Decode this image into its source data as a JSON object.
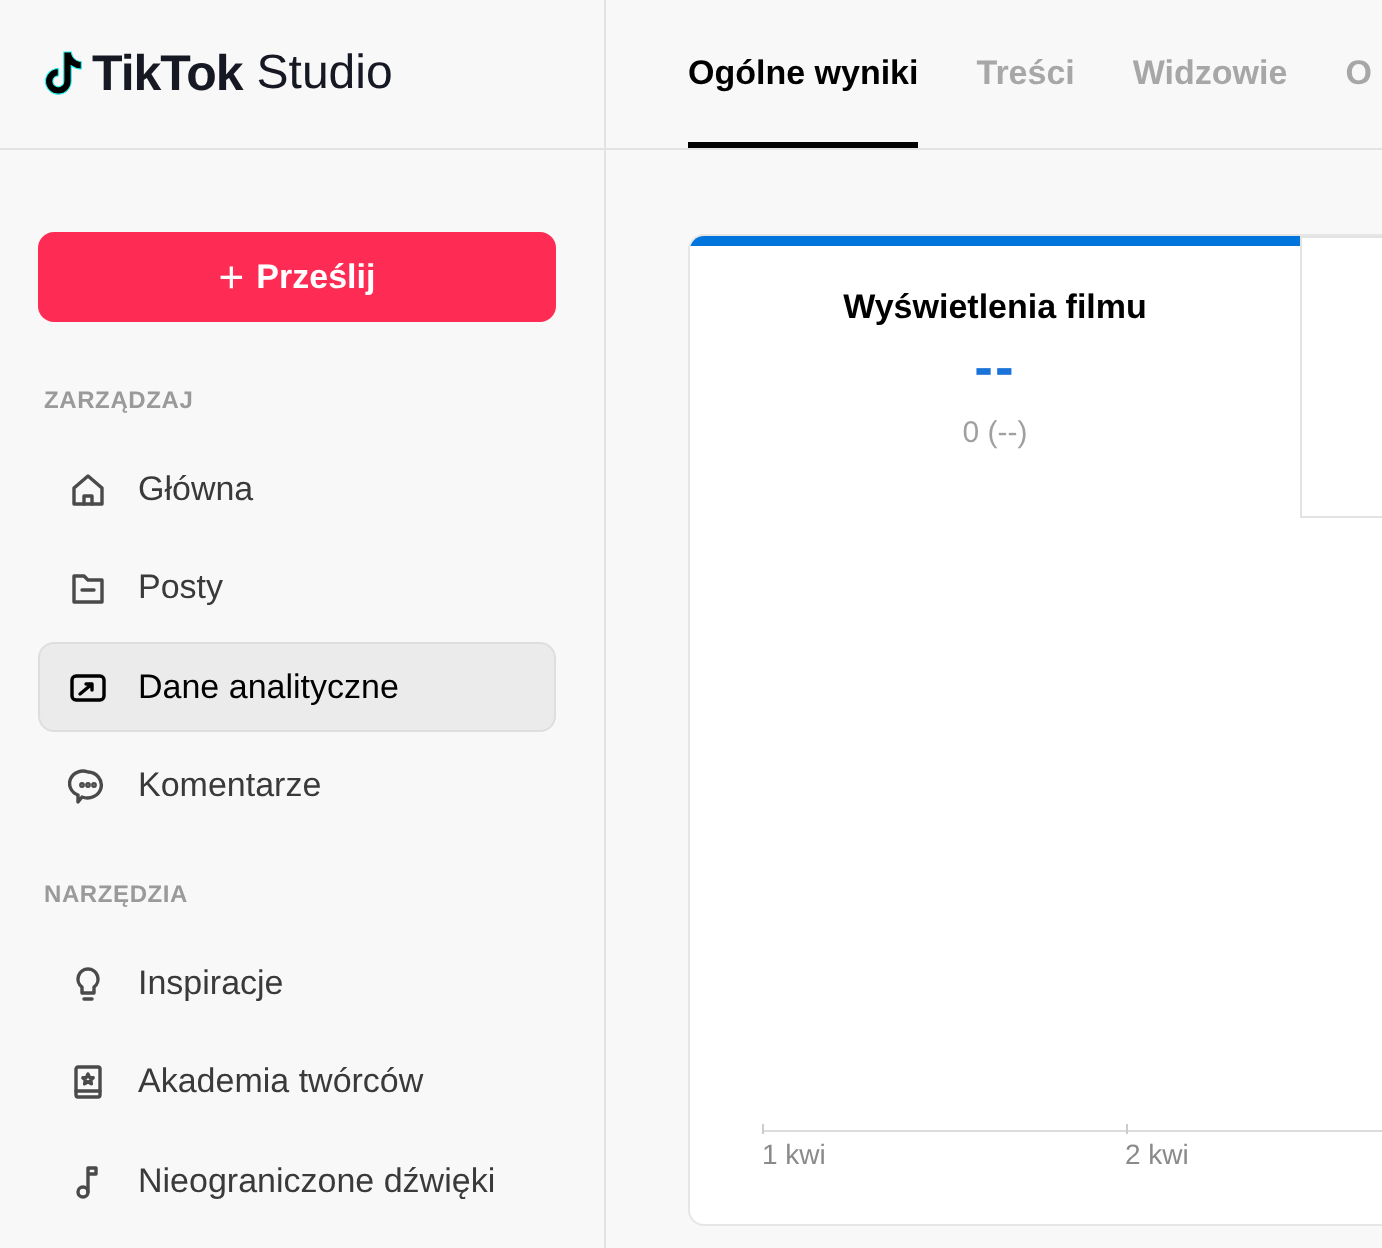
{
  "logo": {
    "brand": "TikTok",
    "product": "Studio"
  },
  "tabs": [
    {
      "label": "Ogólne wyniki",
      "selected": true
    },
    {
      "label": "Treści",
      "selected": false
    },
    {
      "label": "Widzowie",
      "selected": false
    },
    {
      "label": "O",
      "selected": false
    }
  ],
  "upload_button": {
    "icon": "+",
    "label": "Prześlij"
  },
  "sidebar": {
    "sections": [
      {
        "heading": "ZARZĄDZAJ",
        "items": [
          {
            "label": "Główna",
            "selected": false
          },
          {
            "label": "Posty",
            "selected": false
          },
          {
            "label": "Dane analityczne",
            "selected": true
          },
          {
            "label": "Komentarze",
            "selected": false
          }
        ]
      },
      {
        "heading": "NARZĘDZIA",
        "items": [
          {
            "label": "Inspiracje",
            "selected": false
          },
          {
            "label": "Akademia twórców",
            "selected": false
          },
          {
            "label": "Nieograniczone dźwięki",
            "selected": false
          }
        ]
      }
    ]
  },
  "metrics": [
    {
      "title": "Wyświetlenia filmu",
      "value": "--",
      "change": "0 (--)",
      "selected": true
    },
    {
      "selected": false
    }
  ],
  "chart": {
    "x_labels": [
      "1 kwi",
      "2 kwi"
    ]
  }
}
